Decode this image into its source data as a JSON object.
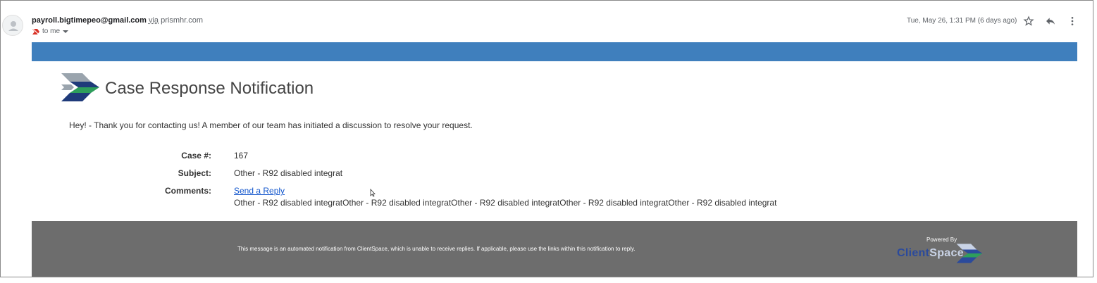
{
  "email": {
    "sender": "payroll.bigtimepeo@gmail.com",
    "via_label": "via",
    "via_domain": "prismhr.com",
    "recipient": "to me",
    "date": "Tue, May 26, 1:31 PM (6 days ago)"
  },
  "notification": {
    "title": "Case Response Notification",
    "intro": "Hey! - Thank you for contacting us! A member of our team has initiated a discussion to resolve your request.",
    "fields": {
      "case_label": "Case #:",
      "case_value": "167",
      "subject_label": "Subject:",
      "subject_value": "Other - R92 disabled integrat",
      "comments_label": "Comments:",
      "reply_link": "Send a Reply",
      "comments_value": "Other - R92 disabled integratOther - R92 disabled integratOther - R92 disabled integratOther - R92 disabled integratOther - R92 disabled integrat"
    }
  },
  "footer": {
    "message": "This message is an automated notification from ClientSpace, which is unable to receive replies. If applicable, please use the links within this notification to reply.",
    "powered_by": "Powered By",
    "brand_client": "Client",
    "brand_space": "Space"
  },
  "colors": {
    "band": "#3f7fbd",
    "footer": "#6d6d6d",
    "link": "#1155cc",
    "logo_navy": "#1f3a7a",
    "logo_green": "#2e9e5b",
    "logo_gray": "#9aa4ad"
  },
  "icons": [
    "avatar-icon",
    "important-marker-icon",
    "dropdown-arrow-icon",
    "star-icon",
    "reply-icon",
    "more-vert-icon",
    "cursor-icon"
  ]
}
